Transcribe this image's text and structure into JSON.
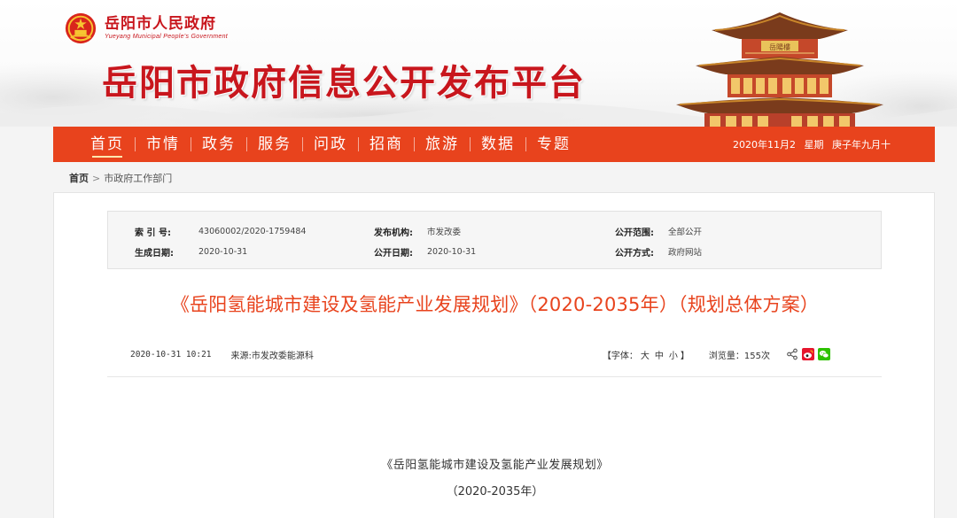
{
  "header": {
    "gov_name": "岳阳市人民政府",
    "gov_name_en": "Yueyang Municipal People's Government",
    "platform_title": "岳阳市政府信息公开发布平台",
    "pavilion_plaque": "岳陽樓"
  },
  "nav": {
    "items": [
      {
        "label": "首页",
        "active": true
      },
      {
        "label": "市情"
      },
      {
        "label": "政务"
      },
      {
        "label": "服务"
      },
      {
        "label": "问政"
      },
      {
        "label": "招商"
      },
      {
        "label": "旅游"
      },
      {
        "label": "数据"
      },
      {
        "label": "专题"
      }
    ],
    "date": "2020年11月2",
    "weekday": "星期",
    "lunar": "庚子年九月十"
  },
  "breadcrumb": {
    "home": "首页",
    "separator": ">",
    "current": "市政府工作部门"
  },
  "meta": {
    "index_label": "索 引 号:",
    "index_value": "43060002/2020-1759484",
    "publisher_label": "发布机构:",
    "publisher_value": "市发改委",
    "scope_label": "公开范围:",
    "scope_value": "全部公开",
    "created_label": "生成日期:",
    "created_value": "2020-10-31",
    "published_label": "公开日期:",
    "published_value": "2020-10-31",
    "method_label": "公开方式:",
    "method_value": "政府网站"
  },
  "article": {
    "title": "《岳阳氢能城市建设及氢能产业发展规划》（2020-2035年）（规划总体方案）",
    "datetime": "2020-10-31 10:21",
    "source": "来源:市发改委能源科",
    "font_prefix": "【字体：",
    "font_large": "大",
    "font_medium": "中",
    "font_small": "小",
    "font_suffix": "】",
    "views": "浏览量：155次",
    "body_title": "《岳阳氢能城市建设及氢能产业发展规划》",
    "body_subtitle": "（2020-2035年）"
  },
  "colors": {
    "brand_red": "#c8161d",
    "nav_orange": "#e8431d",
    "title_orange": "#e8431d"
  },
  "icons": {
    "emblem": "national-emblem-icon",
    "share": "share-icon",
    "weibo": "weibo-icon",
    "wechat": "wechat-icon"
  }
}
